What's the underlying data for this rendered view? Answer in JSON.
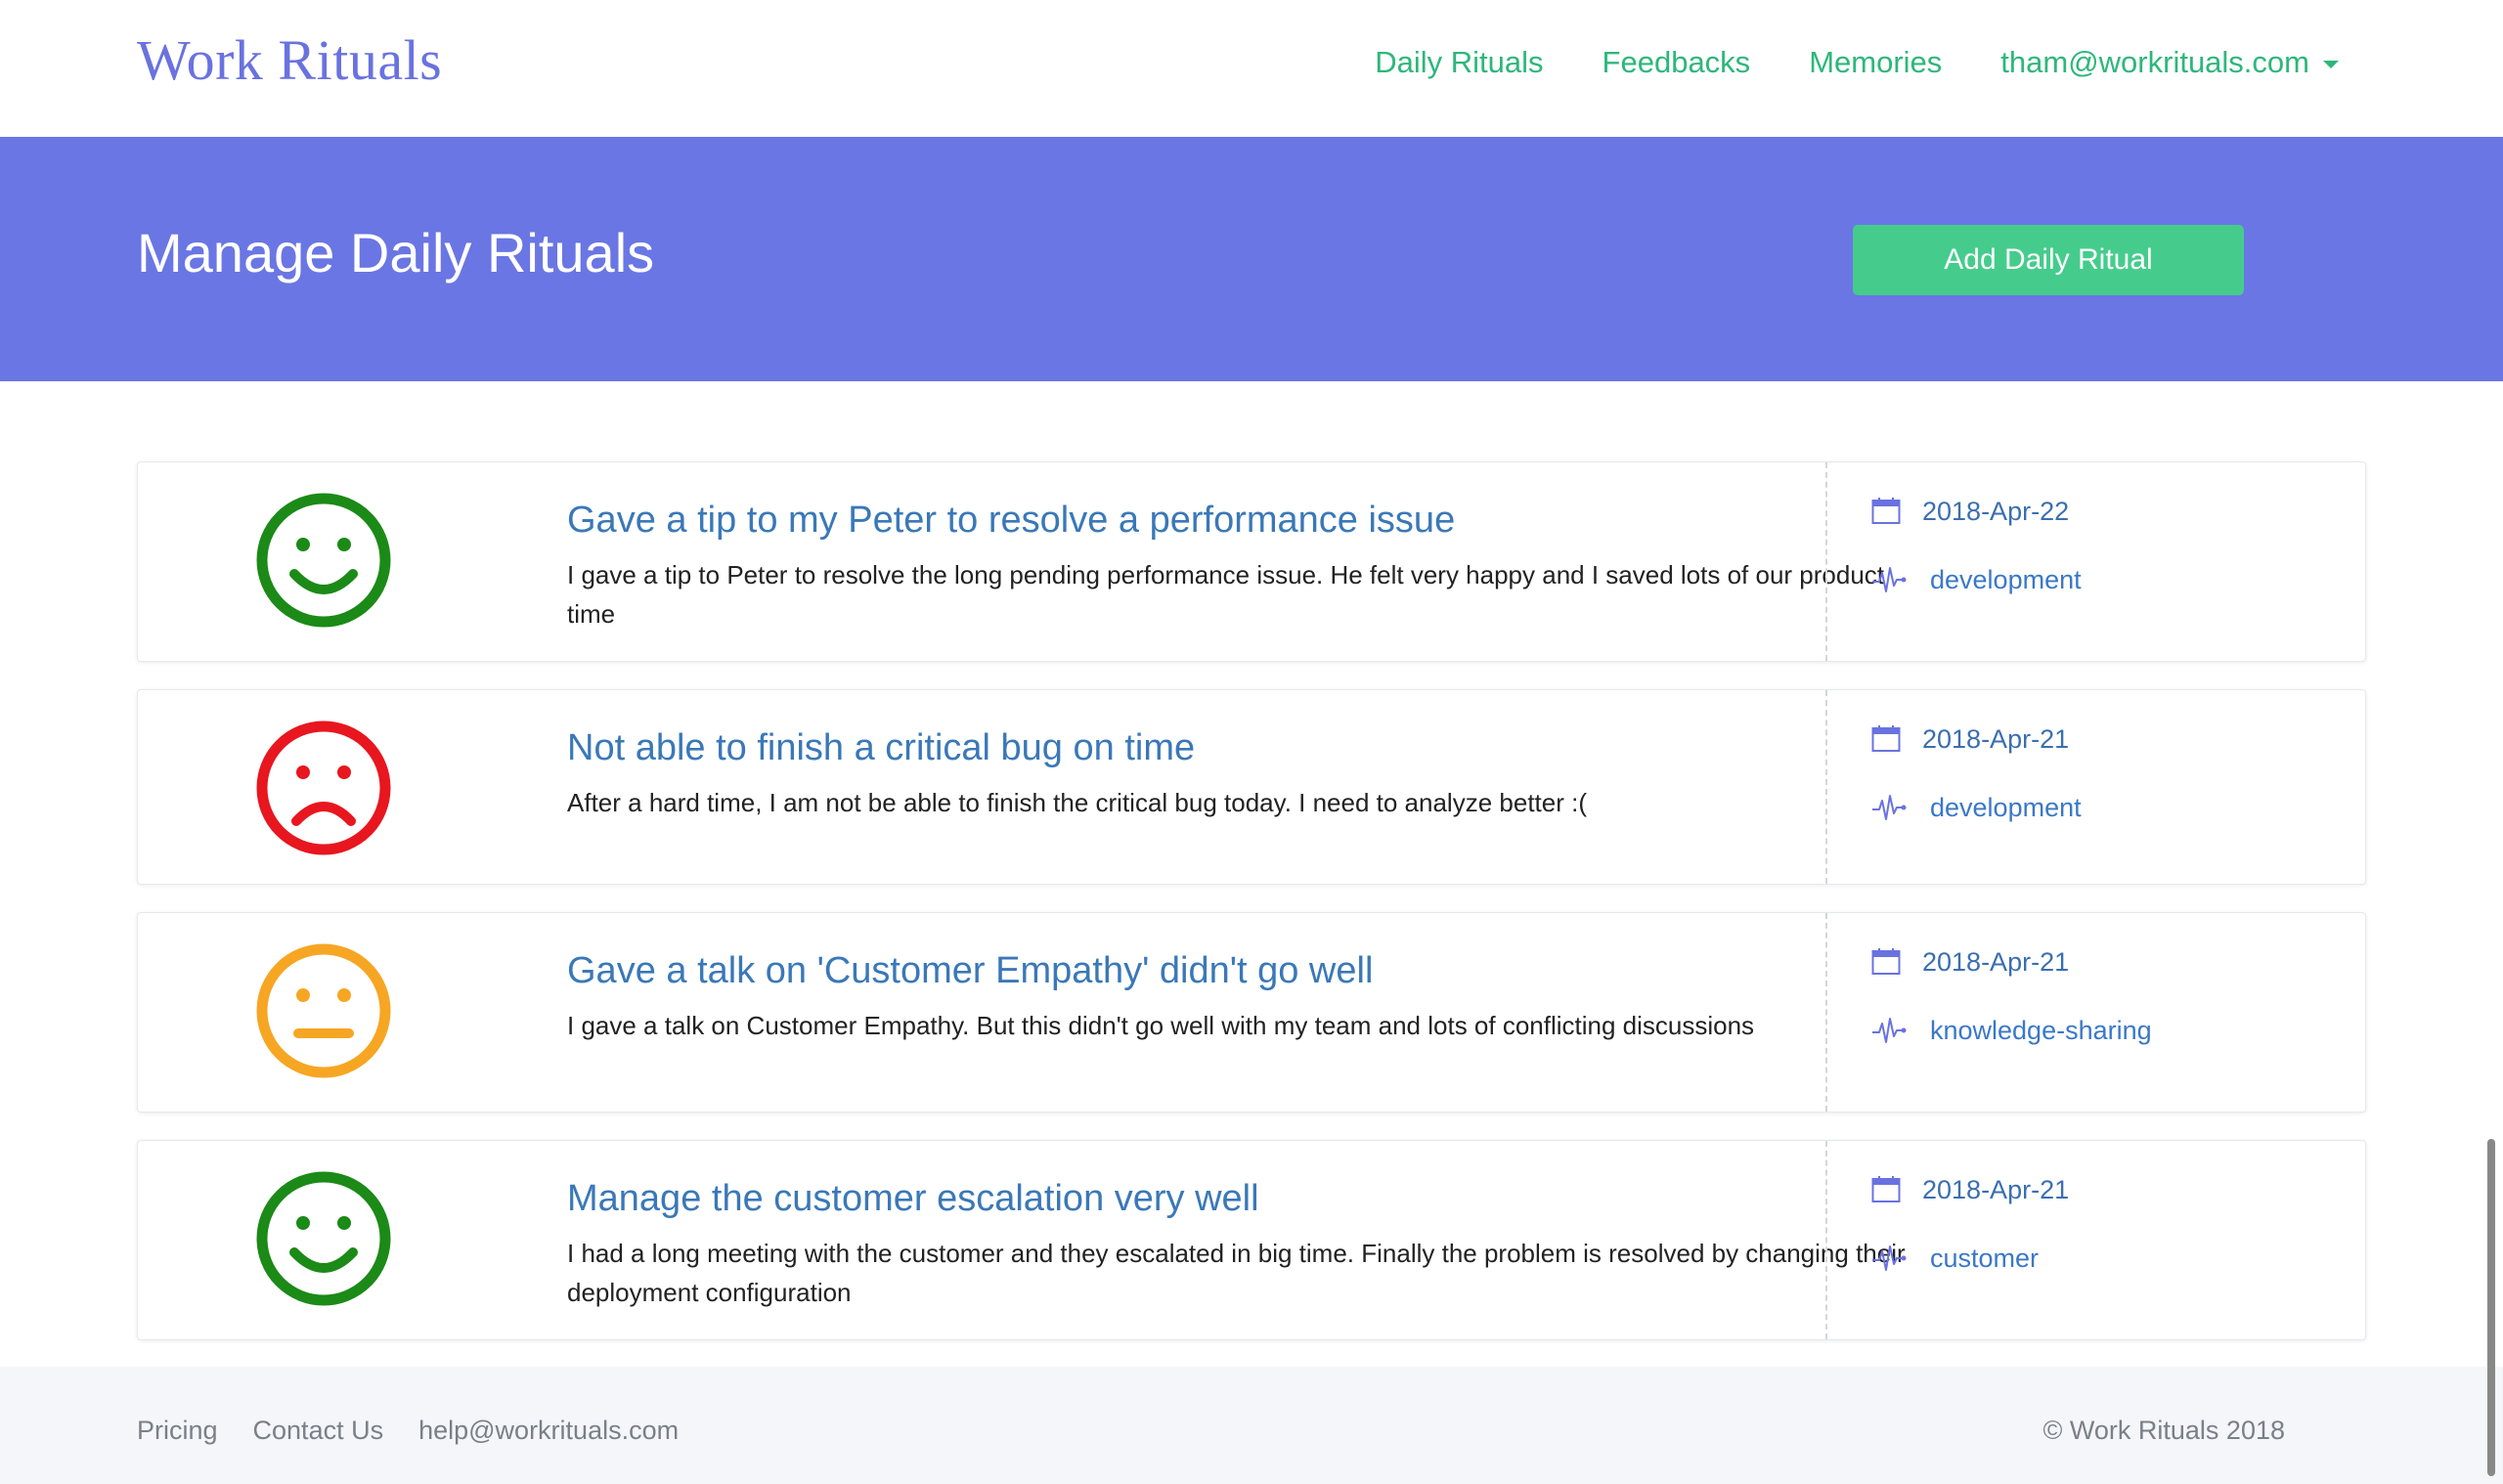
{
  "nav": {
    "logo": "Work Rituals",
    "links": [
      "Daily Rituals",
      "Feedbacks",
      "Memories"
    ],
    "user_email": "tham@workrituals.com",
    "link_color": "#2db77a"
  },
  "banner": {
    "title": "Manage Daily Rituals",
    "add_button_label": "Add Daily Ritual",
    "background": "#6a76e3",
    "button_color": "#45cc8c"
  },
  "rituals": [
    {
      "mood": "happy",
      "mood_color": "#1b8a17",
      "title": "Gave a tip to my Peter to resolve a performance issue",
      "description": "I gave a tip to Peter to resolve the long pending performance issue. He felt very happy and I saved lots of our product time",
      "date": "2018-Apr-22",
      "tag": "development"
    },
    {
      "mood": "sad",
      "mood_color": "#e8161f",
      "title": "Not able to finish a critical bug on time",
      "description": "After a hard time, I am not be able to finish the critical bug today. I need to analyze better :(",
      "date": "2018-Apr-21",
      "tag": "development"
    },
    {
      "mood": "neutral",
      "mood_color": "#f6a623",
      "title": "Gave a talk on 'Customer Empathy' didn't go well",
      "description": "I gave a talk on Customer Empathy. But this didn't go well with my team and lots of conflicting discussions",
      "date": "2018-Apr-21",
      "tag": "knowledge-sharing"
    },
    {
      "mood": "happy",
      "mood_color": "#1b8a17",
      "title": "Manage the customer escalation very well",
      "description": "I had a long meeting with the customer and they escalated in big time. Finally the problem is resolved by changing their deployment configuration",
      "date": "2018-Apr-21",
      "tag": "customer"
    }
  ],
  "icons": {
    "date": "calendar-icon",
    "tag": "activity-pulse-icon"
  },
  "footer": {
    "links": [
      "Pricing",
      "Contact Us",
      "help@workrituals.com"
    ],
    "copyright": "© Work Rituals 2018"
  }
}
